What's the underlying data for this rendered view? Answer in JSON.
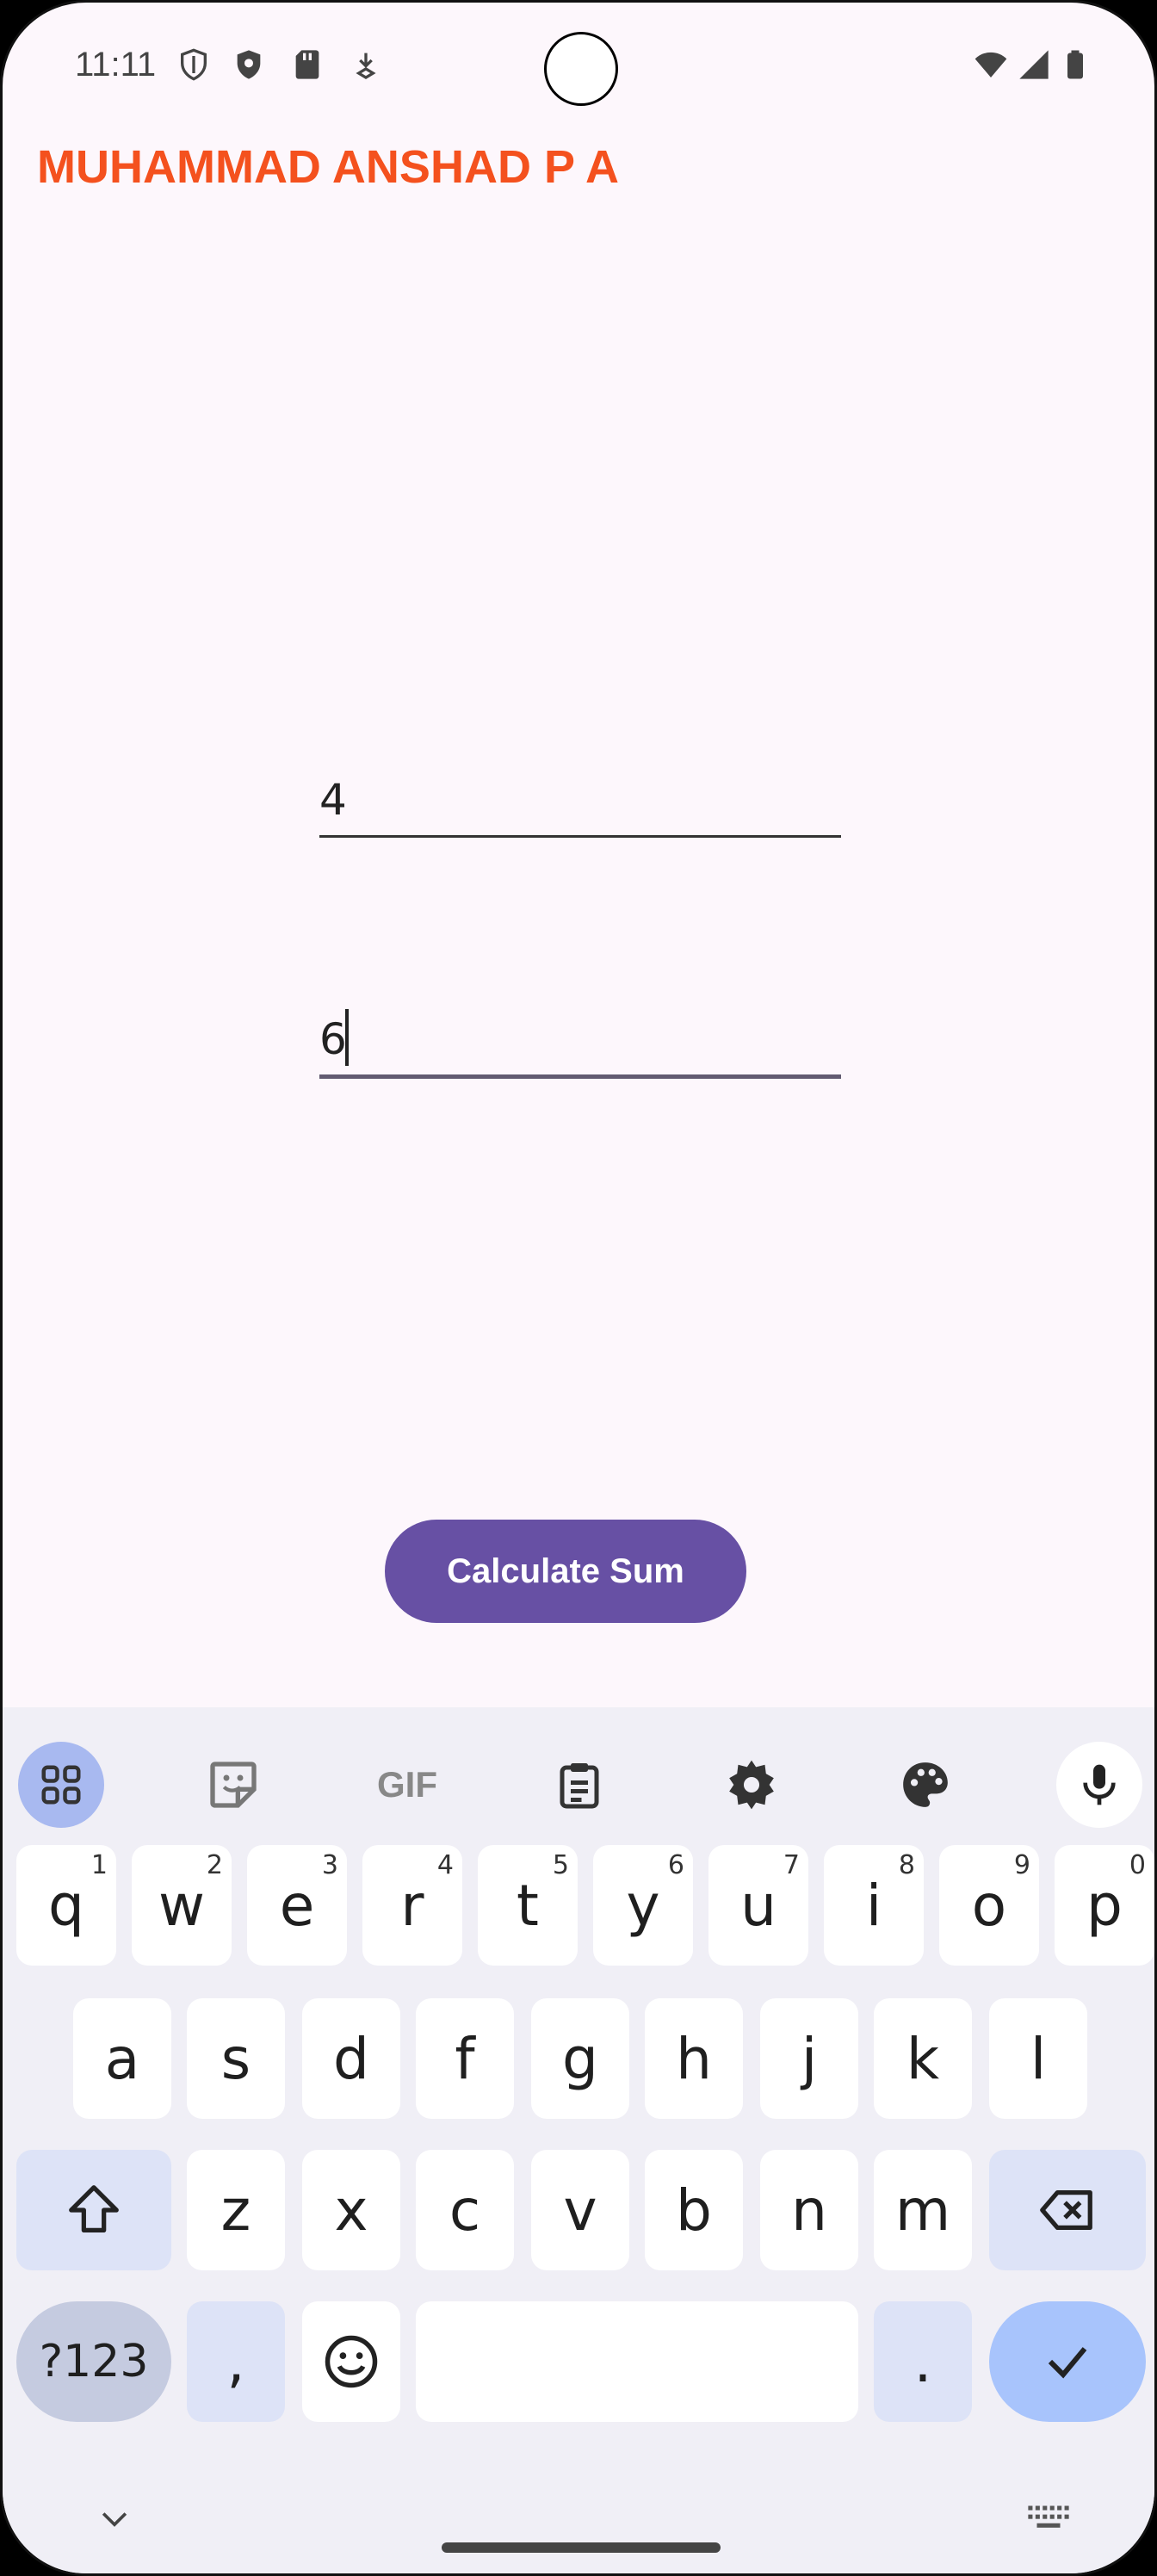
{
  "status_bar": {
    "time": "11:11"
  },
  "app": {
    "title": "MUHAMMAD ANSHAD P A",
    "field1_value": "4",
    "field2_value": "6",
    "button_label": "Calculate Sum"
  },
  "keyboard": {
    "row1": [
      {
        "key": "q",
        "hint": "1"
      },
      {
        "key": "w",
        "hint": "2"
      },
      {
        "key": "e",
        "hint": "3"
      },
      {
        "key": "r",
        "hint": "4"
      },
      {
        "key": "t",
        "hint": "5"
      },
      {
        "key": "y",
        "hint": "6"
      },
      {
        "key": "u",
        "hint": "7"
      },
      {
        "key": "i",
        "hint": "8"
      },
      {
        "key": "o",
        "hint": "9"
      },
      {
        "key": "p",
        "hint": "0"
      }
    ],
    "row2": [
      "a",
      "s",
      "d",
      "f",
      "g",
      "h",
      "j",
      "k",
      "l"
    ],
    "row3": [
      "z",
      "x",
      "c",
      "v",
      "b",
      "n",
      "m"
    ],
    "symbols_label": "?123",
    "comma_label": ",",
    "period_label": ".",
    "gif_label": "GIF"
  },
  "colors": {
    "title": "#f4511e",
    "button": "#6750a4",
    "background": "#fdf7fc",
    "keyboard_bg": "#f0eff6"
  }
}
